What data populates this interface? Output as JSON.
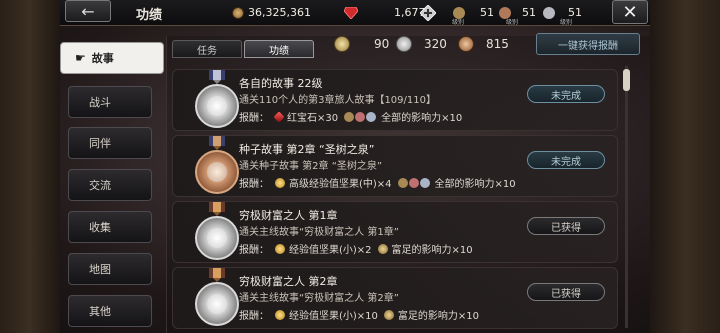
{
  "header": {
    "title": "功绩",
    "gold": "36,325,361",
    "ruby": "1,677",
    "level_a": "51",
    "level_b": "51",
    "level_c": "51",
    "level_caption": "级别"
  },
  "sidebar": {
    "items": [
      {
        "label": "故事",
        "active": true
      },
      {
        "label": "战斗"
      },
      {
        "label": "同伴"
      },
      {
        "label": "交流"
      },
      {
        "label": "收集"
      },
      {
        "label": "地图"
      },
      {
        "label": "其他"
      }
    ]
  },
  "tabs": [
    {
      "label": "任务"
    },
    {
      "label": "功绩",
      "active": true
    }
  ],
  "medal_counts": {
    "gold": "90",
    "silver": "320",
    "bronze": "815"
  },
  "claim_all_label": "一键获得报酬",
  "rows": [
    {
      "title": "各自的故事 22级",
      "desc": "通关110个人的第3章旅人故事【109/110】",
      "reward_label": "报酬：",
      "reward_1": "红宝石×30",
      "reward_2": "全部的影响力×10",
      "status": "未完成",
      "medal": "silver"
    },
    {
      "title": "种子故事 第2章 “圣树之泉”",
      "desc": "通关种子故事 第2章 “圣树之泉”",
      "reward_label": "报酬：",
      "reward_1": "高级经验值坚果(中)×4",
      "reward_2": "全部的影响力×10",
      "status": "未完成",
      "medal": "bronze"
    },
    {
      "title": "穷极财富之人 第1章",
      "desc": "通关主线故事“穷极财富之人 第1章”",
      "reward_label": "报酬：",
      "reward_1": "经验值坚果(小)×2",
      "reward_2": "富足的影响力×10",
      "status": "已获得",
      "medal": "silver"
    },
    {
      "title": "穷极财富之人 第2章",
      "desc": "通关主线故事“穷极财富之人 第2章”",
      "reward_label": "报酬：",
      "reward_1": "经验值坚果(小)×10",
      "reward_2": "富足的影响力×10",
      "status": "已获得",
      "medal": "silver"
    }
  ]
}
